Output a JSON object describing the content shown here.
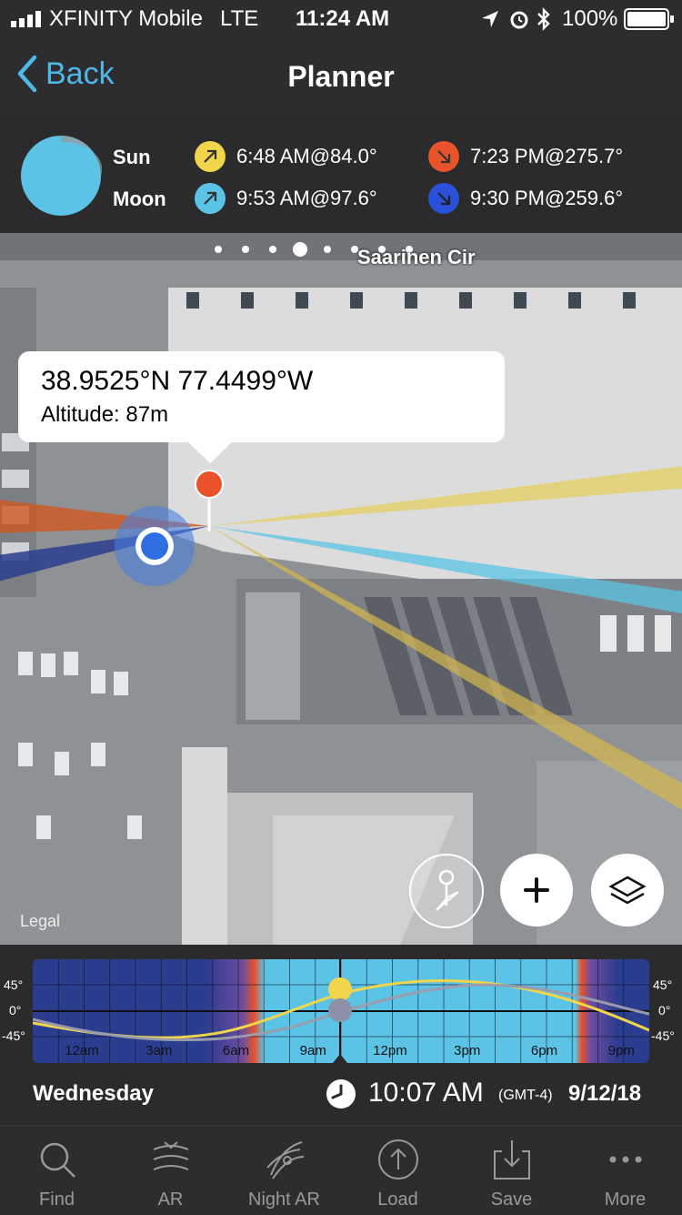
{
  "status": {
    "carrier": "XFINITY Mobile",
    "network": "LTE",
    "time": "11:24 AM",
    "battery": "100%"
  },
  "nav": {
    "back": "Back",
    "title": "Planner"
  },
  "info": {
    "sun_label": "Sun",
    "moon_label": "Moon",
    "sunrise": "6:48 AM@84.0°",
    "sunset": "7:23 PM@275.7°",
    "moonrise": "9:53 AM@97.6°",
    "moonset": "9:30 PM@259.6°",
    "colors": {
      "sunrise": "#f1d54a",
      "sunset": "#e8532b",
      "moonrise": "#5bc4e6",
      "moonset": "#2a4fd8"
    }
  },
  "map": {
    "street": "Saarinen Cir",
    "coords": "38.9525°N 77.4499°W",
    "altitude": "Altitude: 87m",
    "legal": "Legal",
    "page_dots": 8,
    "active_dot": 3
  },
  "timeline": {
    "y_labels": [
      "45°",
      "0°",
      "-45°"
    ],
    "hour_labels": [
      "12am",
      "3am",
      "6am",
      "9am",
      "12pm",
      "3pm",
      "6pm",
      "9pm"
    ],
    "day": "Wednesday",
    "time": "10:07 AM",
    "tz": "(GMT-4)",
    "date": "9/12/18"
  },
  "tabs": [
    {
      "label": "Find",
      "icon": "search-icon"
    },
    {
      "label": "AR",
      "icon": "ar-icon"
    },
    {
      "label": "Night AR",
      "icon": "night-ar-icon"
    },
    {
      "label": "Load",
      "icon": "load-icon"
    },
    {
      "label": "Save",
      "icon": "save-icon"
    },
    {
      "label": "More",
      "icon": "more-icon"
    }
  ]
}
